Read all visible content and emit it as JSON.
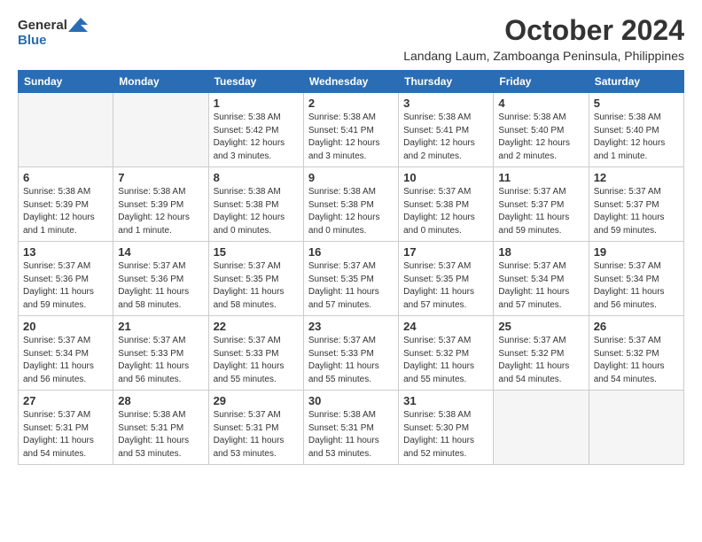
{
  "logo": {
    "general": "General",
    "blue": "Blue"
  },
  "title": "October 2024",
  "subtitle": "Landang Laum, Zamboanga Peninsula, Philippines",
  "weekdays": [
    "Sunday",
    "Monday",
    "Tuesday",
    "Wednesday",
    "Thursday",
    "Friday",
    "Saturday"
  ],
  "weeks": [
    [
      {
        "day": "",
        "empty": true
      },
      {
        "day": "",
        "empty": true
      },
      {
        "day": "1",
        "sunrise": "Sunrise: 5:38 AM",
        "sunset": "Sunset: 5:42 PM",
        "daylight": "Daylight: 12 hours and 3 minutes."
      },
      {
        "day": "2",
        "sunrise": "Sunrise: 5:38 AM",
        "sunset": "Sunset: 5:41 PM",
        "daylight": "Daylight: 12 hours and 3 minutes."
      },
      {
        "day": "3",
        "sunrise": "Sunrise: 5:38 AM",
        "sunset": "Sunset: 5:41 PM",
        "daylight": "Daylight: 12 hours and 2 minutes."
      },
      {
        "day": "4",
        "sunrise": "Sunrise: 5:38 AM",
        "sunset": "Sunset: 5:40 PM",
        "daylight": "Daylight: 12 hours and 2 minutes."
      },
      {
        "day": "5",
        "sunrise": "Sunrise: 5:38 AM",
        "sunset": "Sunset: 5:40 PM",
        "daylight": "Daylight: 12 hours and 1 minute."
      }
    ],
    [
      {
        "day": "6",
        "sunrise": "Sunrise: 5:38 AM",
        "sunset": "Sunset: 5:39 PM",
        "daylight": "Daylight: 12 hours and 1 minute."
      },
      {
        "day": "7",
        "sunrise": "Sunrise: 5:38 AM",
        "sunset": "Sunset: 5:39 PM",
        "daylight": "Daylight: 12 hours and 1 minute."
      },
      {
        "day": "8",
        "sunrise": "Sunrise: 5:38 AM",
        "sunset": "Sunset: 5:38 PM",
        "daylight": "Daylight: 12 hours and 0 minutes."
      },
      {
        "day": "9",
        "sunrise": "Sunrise: 5:38 AM",
        "sunset": "Sunset: 5:38 PM",
        "daylight": "Daylight: 12 hours and 0 minutes."
      },
      {
        "day": "10",
        "sunrise": "Sunrise: 5:37 AM",
        "sunset": "Sunset: 5:38 PM",
        "daylight": "Daylight: 12 hours and 0 minutes."
      },
      {
        "day": "11",
        "sunrise": "Sunrise: 5:37 AM",
        "sunset": "Sunset: 5:37 PM",
        "daylight": "Daylight: 11 hours and 59 minutes."
      },
      {
        "day": "12",
        "sunrise": "Sunrise: 5:37 AM",
        "sunset": "Sunset: 5:37 PM",
        "daylight": "Daylight: 11 hours and 59 minutes."
      }
    ],
    [
      {
        "day": "13",
        "sunrise": "Sunrise: 5:37 AM",
        "sunset": "Sunset: 5:36 PM",
        "daylight": "Daylight: 11 hours and 59 minutes."
      },
      {
        "day": "14",
        "sunrise": "Sunrise: 5:37 AM",
        "sunset": "Sunset: 5:36 PM",
        "daylight": "Daylight: 11 hours and 58 minutes."
      },
      {
        "day": "15",
        "sunrise": "Sunrise: 5:37 AM",
        "sunset": "Sunset: 5:35 PM",
        "daylight": "Daylight: 11 hours and 58 minutes."
      },
      {
        "day": "16",
        "sunrise": "Sunrise: 5:37 AM",
        "sunset": "Sunset: 5:35 PM",
        "daylight": "Daylight: 11 hours and 57 minutes."
      },
      {
        "day": "17",
        "sunrise": "Sunrise: 5:37 AM",
        "sunset": "Sunset: 5:35 PM",
        "daylight": "Daylight: 11 hours and 57 minutes."
      },
      {
        "day": "18",
        "sunrise": "Sunrise: 5:37 AM",
        "sunset": "Sunset: 5:34 PM",
        "daylight": "Daylight: 11 hours and 57 minutes."
      },
      {
        "day": "19",
        "sunrise": "Sunrise: 5:37 AM",
        "sunset": "Sunset: 5:34 PM",
        "daylight": "Daylight: 11 hours and 56 minutes."
      }
    ],
    [
      {
        "day": "20",
        "sunrise": "Sunrise: 5:37 AM",
        "sunset": "Sunset: 5:34 PM",
        "daylight": "Daylight: 11 hours and 56 minutes."
      },
      {
        "day": "21",
        "sunrise": "Sunrise: 5:37 AM",
        "sunset": "Sunset: 5:33 PM",
        "daylight": "Daylight: 11 hours and 56 minutes."
      },
      {
        "day": "22",
        "sunrise": "Sunrise: 5:37 AM",
        "sunset": "Sunset: 5:33 PM",
        "daylight": "Daylight: 11 hours and 55 minutes."
      },
      {
        "day": "23",
        "sunrise": "Sunrise: 5:37 AM",
        "sunset": "Sunset: 5:33 PM",
        "daylight": "Daylight: 11 hours and 55 minutes."
      },
      {
        "day": "24",
        "sunrise": "Sunrise: 5:37 AM",
        "sunset": "Sunset: 5:32 PM",
        "daylight": "Daylight: 11 hours and 55 minutes."
      },
      {
        "day": "25",
        "sunrise": "Sunrise: 5:37 AM",
        "sunset": "Sunset: 5:32 PM",
        "daylight": "Daylight: 11 hours and 54 minutes."
      },
      {
        "day": "26",
        "sunrise": "Sunrise: 5:37 AM",
        "sunset": "Sunset: 5:32 PM",
        "daylight": "Daylight: 11 hours and 54 minutes."
      }
    ],
    [
      {
        "day": "27",
        "sunrise": "Sunrise: 5:37 AM",
        "sunset": "Sunset: 5:31 PM",
        "daylight": "Daylight: 11 hours and 54 minutes."
      },
      {
        "day": "28",
        "sunrise": "Sunrise: 5:38 AM",
        "sunset": "Sunset: 5:31 PM",
        "daylight": "Daylight: 11 hours and 53 minutes."
      },
      {
        "day": "29",
        "sunrise": "Sunrise: 5:37 AM",
        "sunset": "Sunset: 5:31 PM",
        "daylight": "Daylight: 11 hours and 53 minutes."
      },
      {
        "day": "30",
        "sunrise": "Sunrise: 5:38 AM",
        "sunset": "Sunset: 5:31 PM",
        "daylight": "Daylight: 11 hours and 53 minutes."
      },
      {
        "day": "31",
        "sunrise": "Sunrise: 5:38 AM",
        "sunset": "Sunset: 5:30 PM",
        "daylight": "Daylight: 11 hours and 52 minutes."
      },
      {
        "day": "",
        "empty": true
      },
      {
        "day": "",
        "empty": true
      }
    ]
  ]
}
